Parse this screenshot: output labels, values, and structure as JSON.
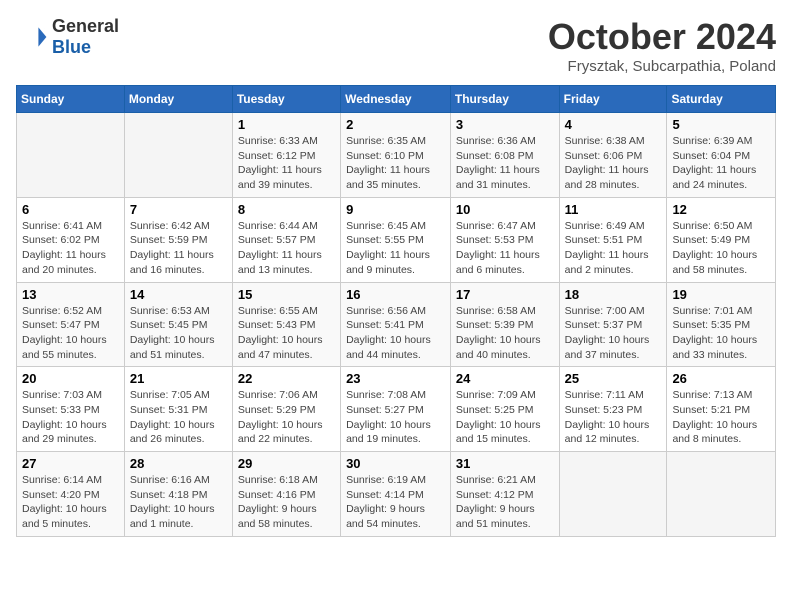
{
  "header": {
    "logo_general": "General",
    "logo_blue": "Blue",
    "month_title": "October 2024",
    "subtitle": "Frysztak, Subcarpathia, Poland"
  },
  "weekdays": [
    "Sunday",
    "Monday",
    "Tuesday",
    "Wednesday",
    "Thursday",
    "Friday",
    "Saturday"
  ],
  "weeks": [
    [
      {
        "day": "",
        "info": ""
      },
      {
        "day": "",
        "info": ""
      },
      {
        "day": "1",
        "info": "Sunrise: 6:33 AM\nSunset: 6:12 PM\nDaylight: 11 hours and 39 minutes."
      },
      {
        "day": "2",
        "info": "Sunrise: 6:35 AM\nSunset: 6:10 PM\nDaylight: 11 hours and 35 minutes."
      },
      {
        "day": "3",
        "info": "Sunrise: 6:36 AM\nSunset: 6:08 PM\nDaylight: 11 hours and 31 minutes."
      },
      {
        "day": "4",
        "info": "Sunrise: 6:38 AM\nSunset: 6:06 PM\nDaylight: 11 hours and 28 minutes."
      },
      {
        "day": "5",
        "info": "Sunrise: 6:39 AM\nSunset: 6:04 PM\nDaylight: 11 hours and 24 minutes."
      }
    ],
    [
      {
        "day": "6",
        "info": "Sunrise: 6:41 AM\nSunset: 6:02 PM\nDaylight: 11 hours and 20 minutes."
      },
      {
        "day": "7",
        "info": "Sunrise: 6:42 AM\nSunset: 5:59 PM\nDaylight: 11 hours and 16 minutes."
      },
      {
        "day": "8",
        "info": "Sunrise: 6:44 AM\nSunset: 5:57 PM\nDaylight: 11 hours and 13 minutes."
      },
      {
        "day": "9",
        "info": "Sunrise: 6:45 AM\nSunset: 5:55 PM\nDaylight: 11 hours and 9 minutes."
      },
      {
        "day": "10",
        "info": "Sunrise: 6:47 AM\nSunset: 5:53 PM\nDaylight: 11 hours and 6 minutes."
      },
      {
        "day": "11",
        "info": "Sunrise: 6:49 AM\nSunset: 5:51 PM\nDaylight: 11 hours and 2 minutes."
      },
      {
        "day": "12",
        "info": "Sunrise: 6:50 AM\nSunset: 5:49 PM\nDaylight: 10 hours and 58 minutes."
      }
    ],
    [
      {
        "day": "13",
        "info": "Sunrise: 6:52 AM\nSunset: 5:47 PM\nDaylight: 10 hours and 55 minutes."
      },
      {
        "day": "14",
        "info": "Sunrise: 6:53 AM\nSunset: 5:45 PM\nDaylight: 10 hours and 51 minutes."
      },
      {
        "day": "15",
        "info": "Sunrise: 6:55 AM\nSunset: 5:43 PM\nDaylight: 10 hours and 47 minutes."
      },
      {
        "day": "16",
        "info": "Sunrise: 6:56 AM\nSunset: 5:41 PM\nDaylight: 10 hours and 44 minutes."
      },
      {
        "day": "17",
        "info": "Sunrise: 6:58 AM\nSunset: 5:39 PM\nDaylight: 10 hours and 40 minutes."
      },
      {
        "day": "18",
        "info": "Sunrise: 7:00 AM\nSunset: 5:37 PM\nDaylight: 10 hours and 37 minutes."
      },
      {
        "day": "19",
        "info": "Sunrise: 7:01 AM\nSunset: 5:35 PM\nDaylight: 10 hours and 33 minutes."
      }
    ],
    [
      {
        "day": "20",
        "info": "Sunrise: 7:03 AM\nSunset: 5:33 PM\nDaylight: 10 hours and 29 minutes."
      },
      {
        "day": "21",
        "info": "Sunrise: 7:05 AM\nSunset: 5:31 PM\nDaylight: 10 hours and 26 minutes."
      },
      {
        "day": "22",
        "info": "Sunrise: 7:06 AM\nSunset: 5:29 PM\nDaylight: 10 hours and 22 minutes."
      },
      {
        "day": "23",
        "info": "Sunrise: 7:08 AM\nSunset: 5:27 PM\nDaylight: 10 hours and 19 minutes."
      },
      {
        "day": "24",
        "info": "Sunrise: 7:09 AM\nSunset: 5:25 PM\nDaylight: 10 hours and 15 minutes."
      },
      {
        "day": "25",
        "info": "Sunrise: 7:11 AM\nSunset: 5:23 PM\nDaylight: 10 hours and 12 minutes."
      },
      {
        "day": "26",
        "info": "Sunrise: 7:13 AM\nSunset: 5:21 PM\nDaylight: 10 hours and 8 minutes."
      }
    ],
    [
      {
        "day": "27",
        "info": "Sunrise: 6:14 AM\nSunset: 4:20 PM\nDaylight: 10 hours and 5 minutes."
      },
      {
        "day": "28",
        "info": "Sunrise: 6:16 AM\nSunset: 4:18 PM\nDaylight: 10 hours and 1 minute."
      },
      {
        "day": "29",
        "info": "Sunrise: 6:18 AM\nSunset: 4:16 PM\nDaylight: 9 hours and 58 minutes."
      },
      {
        "day": "30",
        "info": "Sunrise: 6:19 AM\nSunset: 4:14 PM\nDaylight: 9 hours and 54 minutes."
      },
      {
        "day": "31",
        "info": "Sunrise: 6:21 AM\nSunset: 4:12 PM\nDaylight: 9 hours and 51 minutes."
      },
      {
        "day": "",
        "info": ""
      },
      {
        "day": "",
        "info": ""
      }
    ]
  ]
}
